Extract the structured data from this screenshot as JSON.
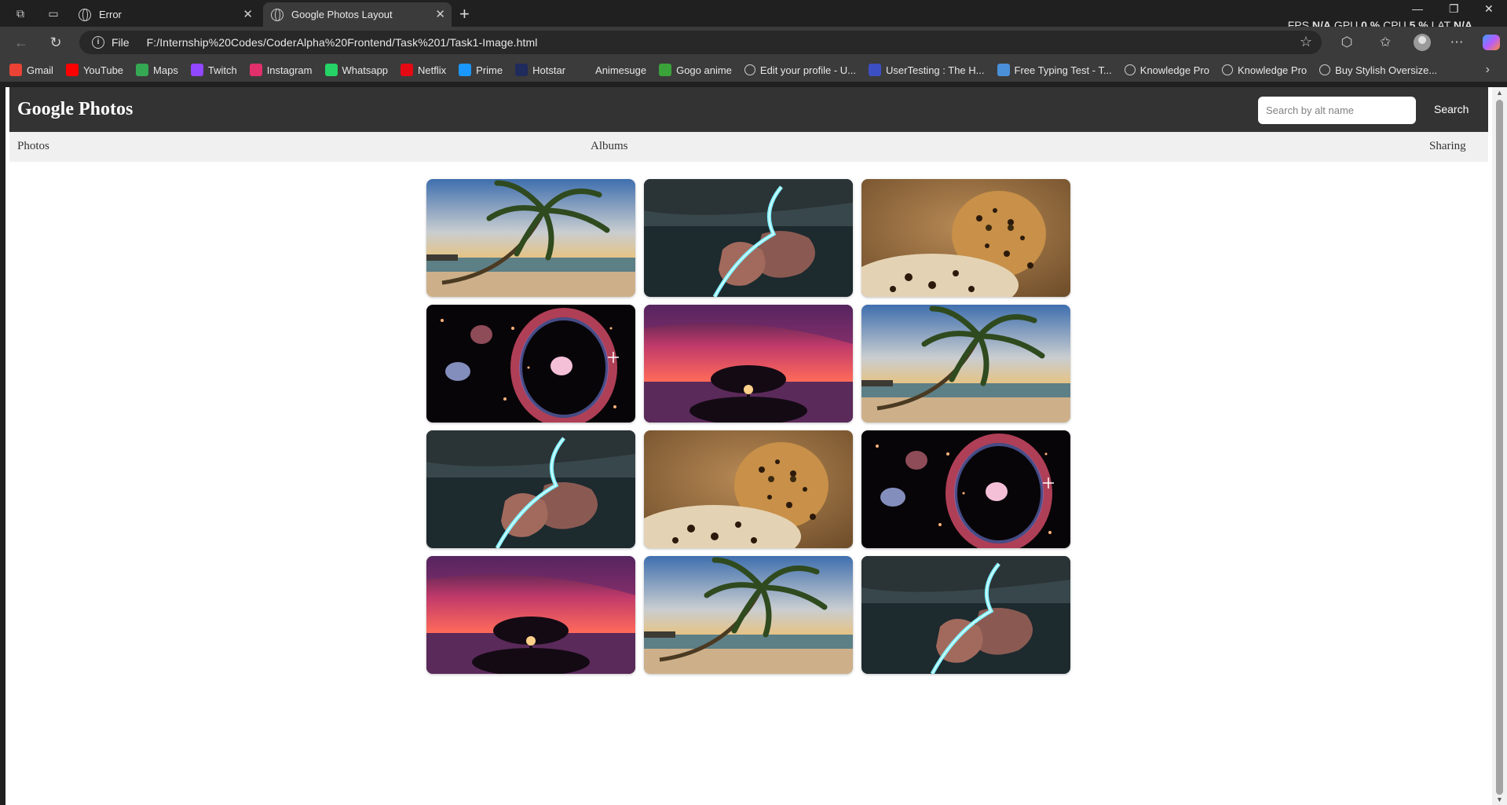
{
  "browser": {
    "tabs": [
      {
        "title": "Error",
        "active": false
      },
      {
        "title": "Google Photos Layout",
        "active": true
      }
    ],
    "perf": {
      "fps_label": "FPS",
      "fps": "N/A",
      "gpu_label": "GPU",
      "gpu": "0 %",
      "cpu_label": "CPU",
      "cpu": "5 %",
      "lat_label": "LAT",
      "lat": "N/A"
    },
    "address": {
      "scheme": "File",
      "url": "F:/Internship%20Codes/CoderAlpha%20Frontend/Task%201/Task1-Image.html"
    },
    "bookmarks": [
      {
        "label": "Gmail",
        "icon": "gmail-icon",
        "color": "#ea4335"
      },
      {
        "label": "YouTube",
        "icon": "youtube-icon",
        "color": "#ff0000"
      },
      {
        "label": "Maps",
        "icon": "maps-icon",
        "color": "#34a853"
      },
      {
        "label": "Twitch",
        "icon": "twitch-icon",
        "color": "#9146ff"
      },
      {
        "label": "Instagram",
        "icon": "instagram-icon",
        "color": "#e1306c"
      },
      {
        "label": "Whatsapp",
        "icon": "whatsapp-icon",
        "color": "#25d366"
      },
      {
        "label": "Netflix",
        "icon": "netflix-icon",
        "color": "#e50914"
      },
      {
        "label": "Prime",
        "icon": "prime-icon",
        "color": "#1a98ff"
      },
      {
        "label": "Hotstar",
        "icon": "hotstar-icon",
        "color": "#1f2b5c"
      },
      {
        "label": "Animesuge",
        "icon": "animesuge-icon",
        "color": "#3b3b3b"
      },
      {
        "label": "Gogo anime",
        "icon": "gogoanime-icon",
        "color": "#3aa33a"
      },
      {
        "label": "Edit your profile - U...",
        "icon": "globe-icon",
        "color": "#3b3b3b"
      },
      {
        "label": "UserTesting : The H...",
        "icon": "usertesting-icon",
        "color": "#3d4fc4"
      },
      {
        "label": "Free Typing Test - T...",
        "icon": "typing-icon",
        "color": "#4a90d9"
      },
      {
        "label": "Knowledge Pro",
        "icon": "globe-icon",
        "color": "#3b3b3b"
      },
      {
        "label": "Knowledge Pro",
        "icon": "globe-icon",
        "color": "#3b3b3b"
      },
      {
        "label": "Buy Stylish Oversize...",
        "icon": "globe-icon",
        "color": "#3b3b3b"
      }
    ]
  },
  "site": {
    "title": "Google Photos",
    "search": {
      "placeholder": "Search by alt name",
      "button": "Search"
    },
    "nav": [
      "Photos",
      "Albums",
      "Sharing"
    ]
  },
  "photos": [
    {
      "subject": "palm-beach"
    },
    {
      "subject": "glowing-river"
    },
    {
      "subject": "leopard"
    },
    {
      "subject": "galaxy"
    },
    {
      "subject": "sunset-tree"
    },
    {
      "subject": "palm-beach"
    },
    {
      "subject": "glowing-river"
    },
    {
      "subject": "leopard"
    },
    {
      "subject": "galaxy"
    },
    {
      "subject": "sunset-tree"
    },
    {
      "subject": "palm-beach"
    },
    {
      "subject": "glowing-river"
    }
  ]
}
